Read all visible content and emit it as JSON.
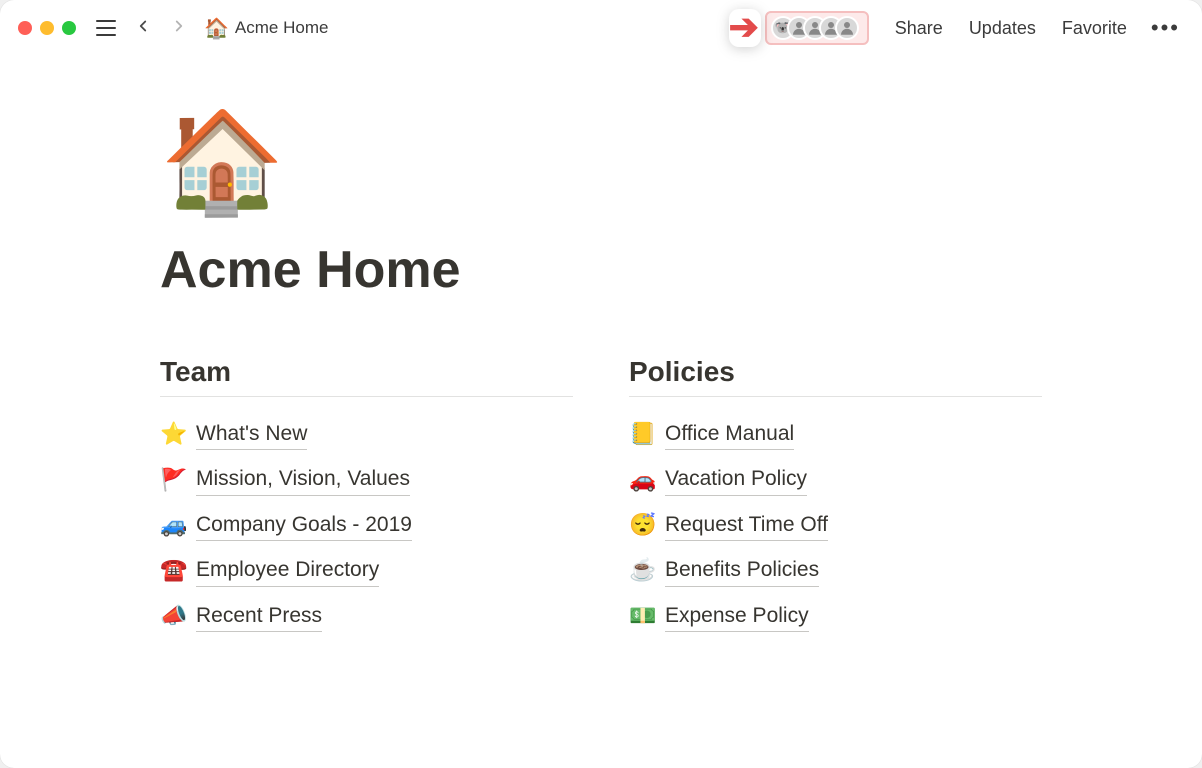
{
  "header": {
    "breadcrumb_icon": "🏠",
    "breadcrumb_label": "Acme Home",
    "share_label": "Share",
    "updates_label": "Updates",
    "favorite_label": "Favorite",
    "presence_avatars": [
      {
        "name": "koala",
        "initial": "🐨"
      },
      {
        "name": "user-2",
        "initial": ""
      },
      {
        "name": "user-3",
        "initial": ""
      },
      {
        "name": "user-4",
        "initial": ""
      },
      {
        "name": "user-5",
        "initial": ""
      }
    ]
  },
  "page": {
    "icon": "🏠",
    "title": "Acme Home"
  },
  "columns": [
    {
      "heading": "Team",
      "items": [
        {
          "icon": "⭐",
          "label": "What's New"
        },
        {
          "icon": "🚩",
          "label": "Mission, Vision, Values"
        },
        {
          "icon": "🚙",
          "label": "Company Goals - 2019"
        },
        {
          "icon": "☎️",
          "label": "Employee Directory"
        },
        {
          "icon": "📣",
          "label": "Recent Press"
        }
      ]
    },
    {
      "heading": "Policies",
      "items": [
        {
          "icon": "📒",
          "label": "Office Manual"
        },
        {
          "icon": "🚗",
          "label": "Vacation Policy"
        },
        {
          "icon": "😴",
          "label": "Request Time Off"
        },
        {
          "icon": "☕",
          "label": "Benefits Policies"
        },
        {
          "icon": "💵",
          "label": "Expense Policy"
        }
      ]
    }
  ]
}
